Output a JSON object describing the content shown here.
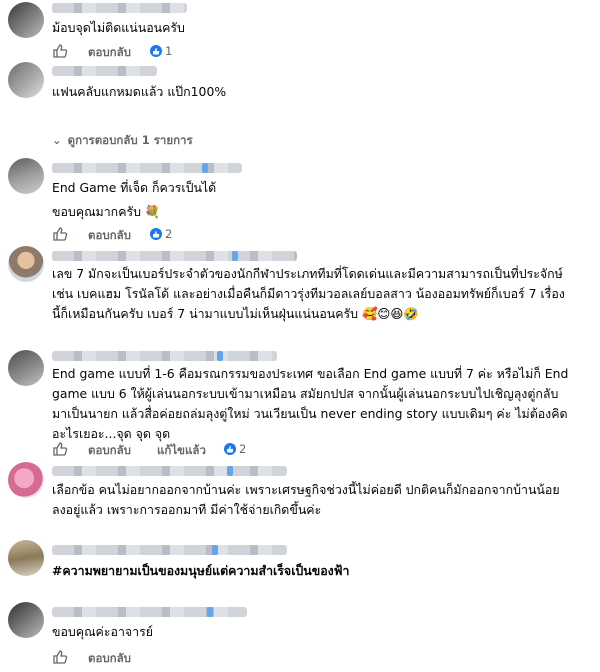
{
  "comments": [
    {
      "text_lines": [
        "ม้อบจุดไม่ติดแน่นอนครับ"
      ],
      "reply_label": "ตอบกลับ",
      "reaction_count": "1"
    },
    {
      "text_lines": [
        "แฟนคลับแกหมดแล้ว แป๊ก100%"
      ]
    },
    {
      "text_lines": [
        "End Game ที่เจ็ด ก็ควรเป็นได้"
      ],
      "second_text": "ขอบคุณมากครับ 💐",
      "reply_label": "ตอบกลับ",
      "reaction_count": "2"
    },
    {
      "text_lines": [
        "เลข 7 มักจะเป็นเบอร์ประจำตัวของนักกีฬาประเภททีมที่โดดเด่นและมีความสามารถเป็นที่ประจักษ์",
        "เช่น เบคแฮม โรนัลโด้ และอย่างเมื่อคืนก็มีดาวรุ่งทีมวอลเลย์บอลสาว น้องออมทรัพย์ก็เบอร์ 7 เรื่อง",
        "นี้ก็เหมือนกันครับ เบอร์ 7 น่ามาแบบไม่เห็นฝุ่นแน่นอนครับ 🥰😊😆🤣"
      ]
    },
    {
      "text_lines": [
        "End game แบบที่ 1-6 คือมรณกรรมของประเทศ ขอเลือก End game แบบที่ 7 ค่ะ หรือไม่ก็ End",
        "game แบบ 6 ให้ผู้เล่นนอกระบบเข้ามาเหมือน สมัยกปปส จากนั้นผู้เล่นนอกระบบไปเชิญลุงตู่กลับ",
        "มาเป็นนายก แล้วสื่อค่อยถล่มลุงตู่ใหม่ วนเวียนเป็น never ending story แบบเดิมๆ ค่ะ ไม่ต้องคิด",
        "อะไรเยอะ...จุด จุด จุด"
      ],
      "reply_label": "ตอบกลับ",
      "edited_label": "แก้ไขแล้ว",
      "reaction_count": "2"
    },
    {
      "text_lines": [
        "เลือกข้อ คนไม่อยากออกจากบ้านค่ะ เพราะเศรษฐกิจช่วงนี้ไม่ค่อยดี ปกติคนก็มักออกจากบ้านน้อย",
        "ลงอยู่แล้ว เพราะการออกมาที มีค่าใช้จ่ายเกิดขึ้นค่ะ"
      ]
    },
    {
      "text_lines": [
        "#ความพยายามเป็นของมนุษย์แต่ความสำเร็จเป็นของฟ้า"
      ]
    },
    {
      "text_lines": [
        "ขอบคุณค่ะอาจารย์"
      ],
      "reply_label": "ตอบกลับ"
    }
  ],
  "view_replies": "ดูการตอบกลับ 1 รายการ",
  "accent_color": "#1877f2",
  "icons": {
    "like": "like-thumb-icon",
    "reaction": "like-reaction-icon",
    "chevron": "chevron-down-icon"
  }
}
